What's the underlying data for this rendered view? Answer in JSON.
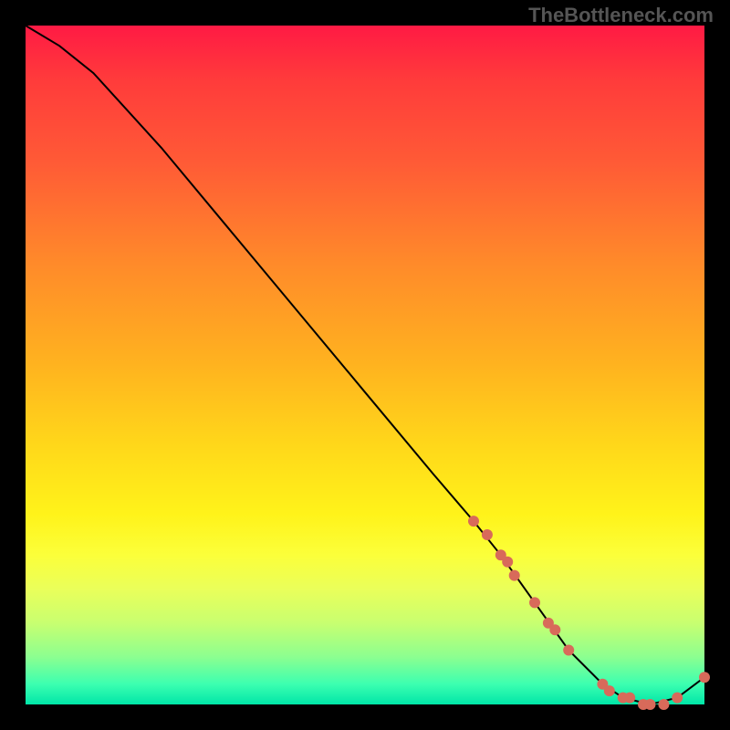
{
  "watermark": "TheBottleneck.com",
  "chart_data": {
    "type": "line",
    "title": "",
    "xlabel": "",
    "ylabel": "",
    "xlim": [
      0,
      100
    ],
    "ylim": [
      0,
      100
    ],
    "series": [
      {
        "name": "curve",
        "x": [
          0,
          5,
          10,
          20,
          30,
          40,
          50,
          60,
          66,
          70,
          75,
          80,
          85,
          88,
          92,
          96,
          100
        ],
        "values": [
          100,
          97,
          93,
          82,
          70,
          58,
          46,
          34,
          27,
          22,
          15,
          8,
          3,
          1,
          0,
          1,
          4
        ]
      }
    ],
    "highlight_points": {
      "name": "dots",
      "x": [
        66,
        68,
        70,
        71,
        72,
        75,
        77,
        78,
        80,
        85,
        86,
        88,
        89,
        91,
        92,
        94,
        96,
        100
      ],
      "values": [
        27,
        25,
        22,
        21,
        19,
        15,
        12,
        11,
        8,
        3,
        2,
        1,
        1,
        0,
        0,
        0,
        1,
        4
      ]
    },
    "colors": {
      "curve": "#000000",
      "dots": "#d86a5a"
    }
  }
}
